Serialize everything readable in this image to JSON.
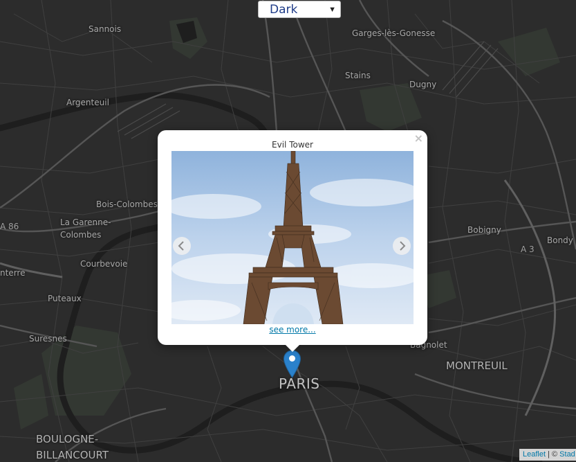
{
  "style_select": {
    "selected": "Dark"
  },
  "places": {
    "sannois": "Sannois",
    "garges": "Garges-lès-Gonesse",
    "stains": "Stains",
    "dugny": "Dugny",
    "argenteuil": "Argenteuil",
    "bois_colombes": "Bois-Colombes",
    "la_garenne_1": "La Garenne-",
    "la_garenne_2": "Colombes",
    "courbevoie": "Courbevoie",
    "nanterre": "nterre",
    "puteaux": "Puteaux",
    "suresnes": "Suresnes",
    "bobigny": "Bobigny",
    "bondy": "Bondy",
    "bagnolet": "Bagnolet",
    "montreuil": "MONTREUIL",
    "paris": "PARIS",
    "boulogne_1": "BOULOGNE-",
    "boulogne_2": "BILLANCOURT"
  },
  "shields": {
    "a86": "A 86",
    "a3": "A 3"
  },
  "popup": {
    "title": "Evil Tower",
    "close": "×",
    "link_text": "see more..."
  },
  "attribution": {
    "leaflet": "Leaflet",
    "separator": " | © ",
    "stadia": "Stad"
  },
  "colors": {
    "map_background": "#2c2c2c",
    "road": "#4a4a4a",
    "major_road": "#5e5e5e",
    "water": "#1f1f1f",
    "park": "#343a33",
    "pin": "#2a81cb",
    "link": "#0078a8"
  }
}
